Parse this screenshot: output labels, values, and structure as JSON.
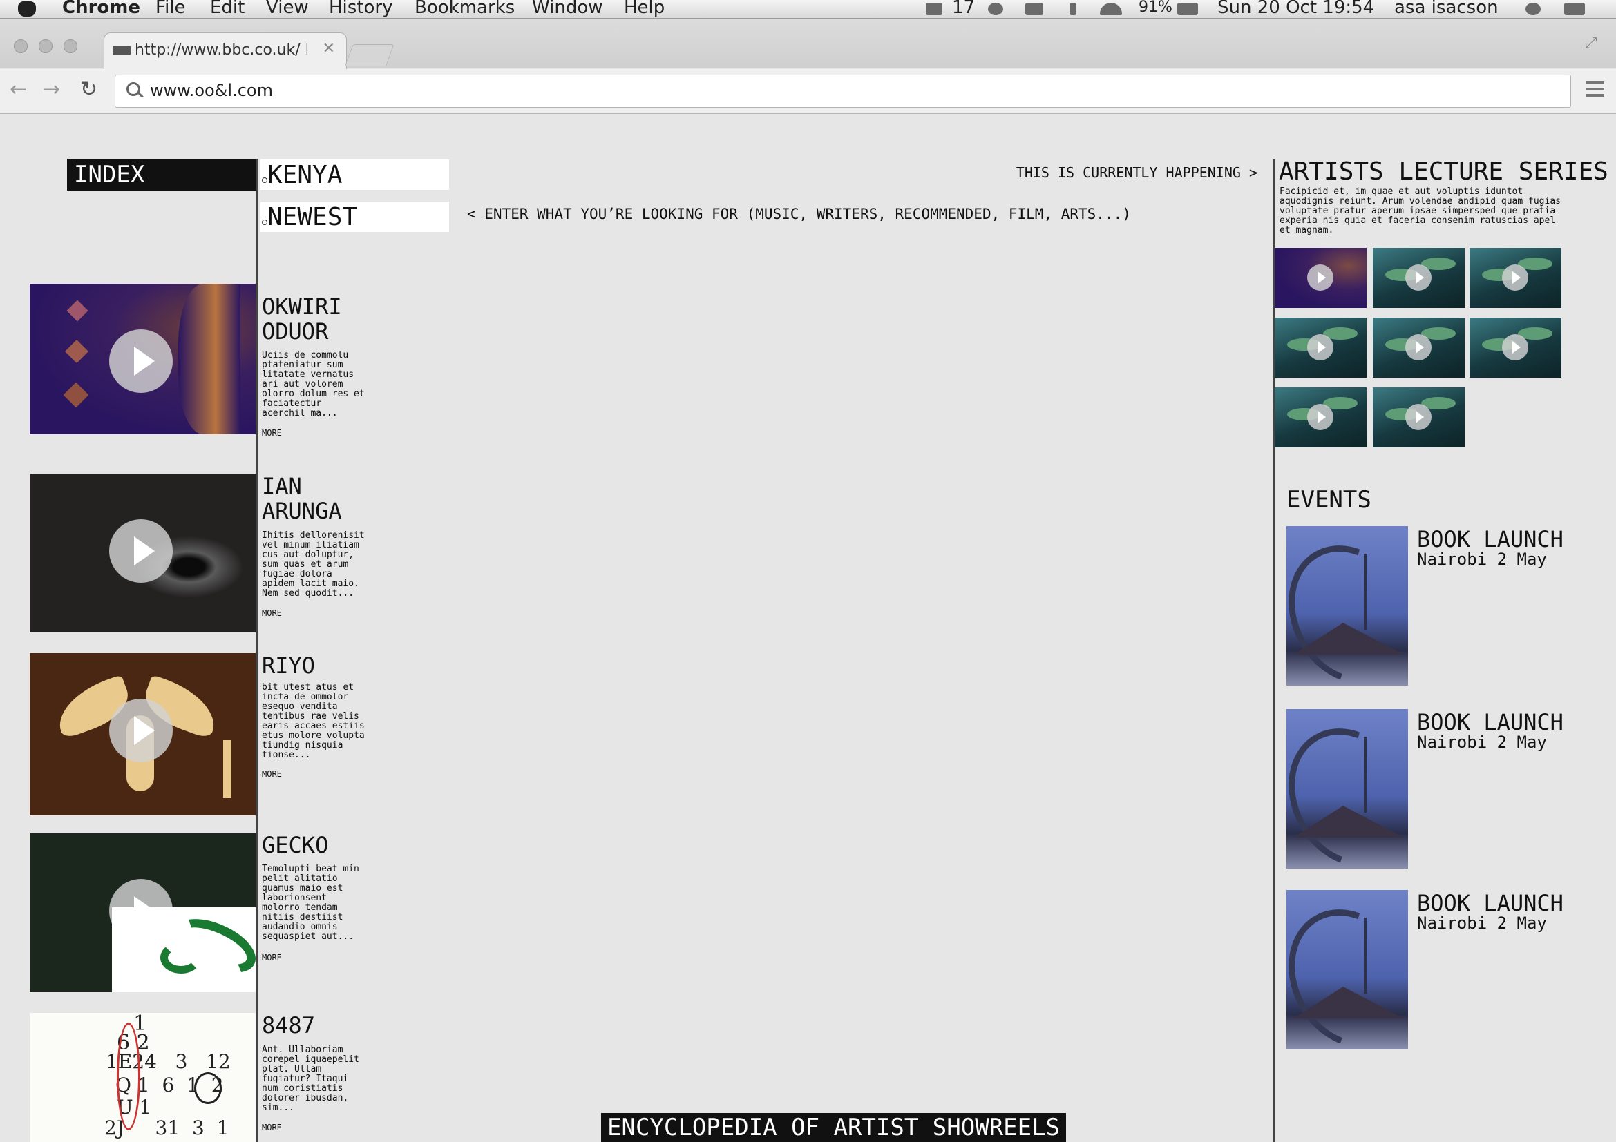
{
  "menubar": {
    "app": "Chrome",
    "items": [
      "File",
      "Edit",
      "View",
      "History",
      "Bookmarks",
      "Window",
      "Help"
    ],
    "status_count": "17",
    "battery": "91%",
    "datetime": "Sun 20 Oct  19:54",
    "user": "asa isacson"
  },
  "browser": {
    "tab_title": "http://www.bbc.co.uk/ In",
    "tab_close": "✕",
    "address": "www.oo&l.com",
    "back": "←",
    "forward": "→",
    "reload": "↻",
    "expand": "⤢"
  },
  "page": {
    "index_label": "INDEX",
    "filter_location": "KENYA",
    "filter_sort": "NEWEST",
    "currently_happening": "THIS IS CURRENTLY HAPPENING >",
    "search_prompt": "<  ENTER WHAT YOU’RE LOOKING FOR (MUSIC, WRITERS, RECOMMENDED, FILM, ARTS...)",
    "artists": [
      {
        "name": "OKWIRI ODUOR",
        "desc": "Uciis de commolu ptateniatur sum litatate vernatus ari aut volorem olorro dolum res et faciatectur acerchil ma...",
        "more": "MORE"
      },
      {
        "name": "IAN ARUNGA",
        "desc": "Ihitis dellorenisit vel minum iliatiam cus aut doluptur, sum quas et arum fugiae dolora apidem lacit maio. Nem sed quodit...",
        "more": "MORE"
      },
      {
        "name": "RIYO",
        "desc": "bit utest atus et incta de ommolor esequo vendita tentibus rae velis earis accaes estiis etus molore volupta tiundig nisquia tionse...",
        "more": "MORE"
      },
      {
        "name": "GECKO",
        "desc": "Temolupti beat min pelit alitatio quamus maio est laborionsent molorro tendam nitiis destiist audandio omnis sequaspiet aut...",
        "more": "MORE"
      },
      {
        "name": "8487",
        "desc": "Ant. Ullaboriam corepel iquaepelit plat. Ullam fugiatur? Itaqui num coristiatis dolorer ibusdan, sim...",
        "more": "MORE"
      }
    ],
    "lecture_series": {
      "title": "ARTISTS LECTURE SERIES",
      "desc": "Facipicid et, im quae et aut voluptis iduntot aquodignis reiunt. Arum volendae andipid quam fugias voluptate pratur aperum ipsae simpersped que pratia experia nis quia et faceria consenim ratuscias apel et magnam."
    },
    "events_title": "EVENTS",
    "events": [
      {
        "title": "BOOK LAUNCH",
        "sub": "Nairobi 2 May"
      },
      {
        "title": "BOOK LAUNCH",
        "sub": "Nairobi 2 May"
      },
      {
        "title": "BOOK LAUNCH",
        "sub": "Nairobi 2 May"
      }
    ],
    "footer_label": "ENCYCLOPEDIA OF ARTIST SHOWREELS",
    "thumb_numbers": {
      "r1": "1",
      "r2": "6 2",
      "r3": "1E24   3   12",
      "r4": "Q 1  6  1  2",
      "r5": "U 1",
      "r6": "2J     31  3  1"
    }
  },
  "colors": {
    "page_bg": "#e6e6e6",
    "ink": "#111111",
    "white": "#ffffff",
    "gecko_green": "#1b7a32"
  },
  "icons": {
    "play": "play-icon",
    "search": "search-icon",
    "menu": "hamburger-menu-icon",
    "wifi": "wifi-icon",
    "battery": "battery-icon",
    "volume": "volume-icon"
  }
}
